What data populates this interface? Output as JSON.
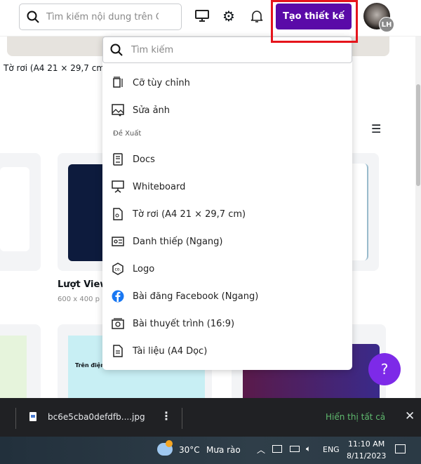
{
  "header": {
    "search_placeholder": "Tìm kiếm nội dung trên Canva",
    "create_button": "Tạo thiết kế",
    "avatar_initials": "LH"
  },
  "background": {
    "card_title_1": "Tờ rơi (A4 21 × 29,7 cm",
    "card_title_2": "Lượt View",
    "card_sub_2": "600 x 400 p",
    "thumb_text": "Trên điện thoại, máy tính"
  },
  "dropdown": {
    "search_placeholder": "Tìm kiếm",
    "items_top": [
      {
        "label": "Cỡ tùy chỉnh",
        "icon": "custom-size-icon"
      },
      {
        "label": "Sửa ảnh",
        "icon": "edit-photo-icon"
      }
    ],
    "section_label": "Đề Xuất",
    "suggestions": [
      {
        "label": "Docs",
        "icon": "docs-icon"
      },
      {
        "label": "Whiteboard",
        "icon": "whiteboard-icon"
      },
      {
        "label": "Tờ rơi (A4 21 × 29,7 cm)",
        "icon": "flyer-icon"
      },
      {
        "label": "Danh thiếp (Ngang)",
        "icon": "business-card-icon"
      },
      {
        "label": "Logo",
        "icon": "logo-icon"
      },
      {
        "label": "Bài đăng Facebook (Ngang)",
        "icon": "facebook-icon"
      },
      {
        "label": "Bài thuyết trình (16:9)",
        "icon": "presentation-icon"
      },
      {
        "label": "Tài liệu (A4 Dọc)",
        "icon": "document-icon"
      }
    ]
  },
  "help": "?",
  "download_bar": {
    "file_name": "bc6e5cba0defdfb....jpg",
    "show_all": "Hiển thị tất cả"
  },
  "taskbar": {
    "temperature": "30°C",
    "weather": "Mưa rào",
    "language": "ENG",
    "time": "11:10 AM",
    "date": "8/11/2023"
  },
  "colors": {
    "brand": "#5a0aa8",
    "highlight": "#e5141c",
    "help": "#7d2ae8",
    "show_all": "#5fb96e"
  }
}
